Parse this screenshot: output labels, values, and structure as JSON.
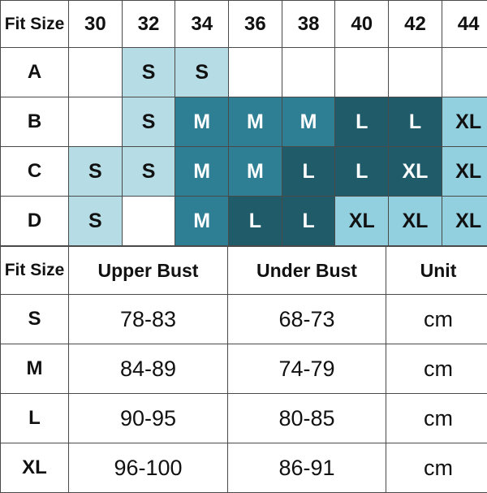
{
  "top_table": {
    "row_header_label": "Fit Size",
    "columns": [
      "30",
      "32",
      "34",
      "36",
      "38",
      "40",
      "42",
      "44"
    ],
    "rows": [
      {
        "label": "A",
        "cells": [
          {
            "text": "",
            "fill": "empty"
          },
          {
            "text": "S",
            "fill": "S"
          },
          {
            "text": "S",
            "fill": "S"
          },
          {
            "text": "",
            "fill": "empty"
          },
          {
            "text": "",
            "fill": "empty"
          },
          {
            "text": "",
            "fill": "empty"
          },
          {
            "text": "",
            "fill": "empty"
          },
          {
            "text": "",
            "fill": "empty"
          }
        ]
      },
      {
        "label": "B",
        "cells": [
          {
            "text": "",
            "fill": "empty"
          },
          {
            "text": "S",
            "fill": "S"
          },
          {
            "text": "M",
            "fill": "M"
          },
          {
            "text": "M",
            "fill": "M"
          },
          {
            "text": "M",
            "fill": "M"
          },
          {
            "text": "L",
            "fill": "L"
          },
          {
            "text": "L",
            "fill": "L"
          },
          {
            "text": "XL",
            "fill": "XL-light"
          }
        ]
      },
      {
        "label": "C",
        "cells": [
          {
            "text": "S",
            "fill": "S"
          },
          {
            "text": "S",
            "fill": "S"
          },
          {
            "text": "M",
            "fill": "M"
          },
          {
            "text": "M",
            "fill": "M"
          },
          {
            "text": "L",
            "fill": "L"
          },
          {
            "text": "L",
            "fill": "L"
          },
          {
            "text": "XL",
            "fill": "XL-dark"
          },
          {
            "text": "XL",
            "fill": "XL-light"
          }
        ]
      },
      {
        "label": "D",
        "cells": [
          {
            "text": "S",
            "fill": "S"
          },
          {
            "text": "",
            "fill": "empty"
          },
          {
            "text": "M",
            "fill": "M"
          },
          {
            "text": "L",
            "fill": "L"
          },
          {
            "text": "L",
            "fill": "L"
          },
          {
            "text": "XL",
            "fill": "XL-light"
          },
          {
            "text": "XL",
            "fill": "XL-light"
          },
          {
            "text": "XL",
            "fill": "XL-light"
          }
        ]
      }
    ]
  },
  "bottom_table": {
    "headers": [
      "Fit Size",
      "Upper Bust",
      "Under Bust",
      "Unit"
    ],
    "rows": [
      {
        "size": "S",
        "upper_bust": "78-83",
        "under_bust": "68-73",
        "unit": "cm"
      },
      {
        "size": "M",
        "upper_bust": "84-89",
        "under_bust": "74-79",
        "unit": "cm"
      },
      {
        "size": "L",
        "upper_bust": "90-95",
        "under_bust": "80-85",
        "unit": "cm"
      },
      {
        "size": "XL",
        "upper_bust": "96-100",
        "under_bust": "86-91",
        "unit": "cm"
      }
    ]
  },
  "colors": {
    "size_S": "#b6dce6",
    "size_M": "#2e7f94",
    "size_L": "#1f5b69",
    "size_XL_light": "#92cfdf",
    "size_XL_dark": "#1f5b69",
    "border": "#4a4a4a",
    "background": "#ffffff",
    "text": "#111111"
  }
}
